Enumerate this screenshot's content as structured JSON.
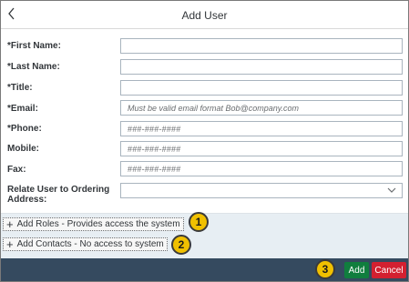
{
  "header": {
    "title": "Add User",
    "back_icon": "chevron-left-icon"
  },
  "form": {
    "first_name": {
      "label": "*First Name:",
      "value": "",
      "placeholder": ""
    },
    "last_name": {
      "label": "*Last Name:",
      "value": "",
      "placeholder": ""
    },
    "title": {
      "label": "*Title:",
      "value": "",
      "placeholder": ""
    },
    "email": {
      "label": "*Email:",
      "value": "",
      "placeholder": "Must be valid email format Bob@company.com"
    },
    "phone": {
      "label": "*Phone:",
      "value": "",
      "placeholder": "###-###-####"
    },
    "mobile": {
      "label": "Mobile:",
      "value": "",
      "placeholder": "###-###-####"
    },
    "fax": {
      "label": "Fax:",
      "value": "",
      "placeholder": "###-###-####"
    },
    "ordering_address": {
      "label_line1": "Relate User to Ordering",
      "label_line2": "Address:",
      "selected": ""
    }
  },
  "actions": {
    "add_roles": "Add Roles - Provides access the system",
    "add_contacts": "Add Contacts - No access to system"
  },
  "callouts": [
    "1",
    "2",
    "3"
  ],
  "footer": {
    "add_label": "Add",
    "cancel_label": "Cancel"
  },
  "colors": {
    "footer_bg": "#354a5f",
    "add": "#107e3e",
    "cancel": "#d32030",
    "callout": "#f0c000"
  }
}
